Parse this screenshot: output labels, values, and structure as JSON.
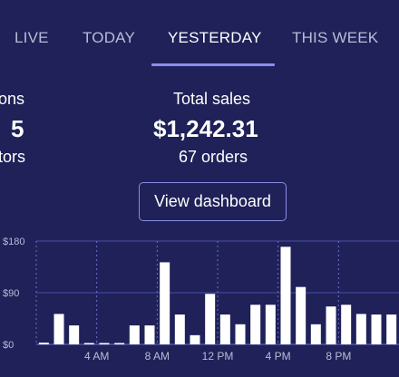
{
  "tabs": [
    {
      "label": "LIVE",
      "active": false
    },
    {
      "label": "TODAY",
      "active": false
    },
    {
      "label": "YESTERDAY",
      "active": true
    },
    {
      "label": "THIS WEEK",
      "active": false
    }
  ],
  "left_stat": {
    "label": "ons",
    "value": "5",
    "sub": "tors"
  },
  "total_sales": {
    "label": "Total sales",
    "value": "$1,242.31",
    "orders": "67 orders"
  },
  "view_dashboard_label": "View dashboard",
  "colors": {
    "background": "#1f2158",
    "accent": "#8c8cf0",
    "bar": "#ffffff"
  },
  "chart_data": {
    "type": "bar",
    "y_ticks": [
      "$180",
      "$90",
      "$0"
    ],
    "ylim": [
      0,
      180
    ],
    "x_ticks": [
      "4 AM",
      "8 AM",
      "12 PM",
      "4 PM",
      "8 PM"
    ],
    "categories": [
      "12 AM",
      "1 AM",
      "2 AM",
      "3 AM",
      "4 AM",
      "5 AM",
      "6 AM",
      "7 AM",
      "8 AM",
      "9 AM",
      "10 AM",
      "11 AM",
      "12 PM",
      "1 PM",
      "2 PM",
      "3 PM",
      "4 PM",
      "5 PM",
      "6 PM",
      "7 PM",
      "8 PM",
      "9 PM",
      "10 PM",
      "11 PM"
    ],
    "values": [
      3,
      53,
      33,
      2,
      2,
      2,
      33,
      33,
      143,
      52,
      16,
      88,
      52,
      35,
      69,
      69,
      170,
      100,
      35,
      66,
      69,
      53,
      52,
      52
    ],
    "grid": true
  }
}
